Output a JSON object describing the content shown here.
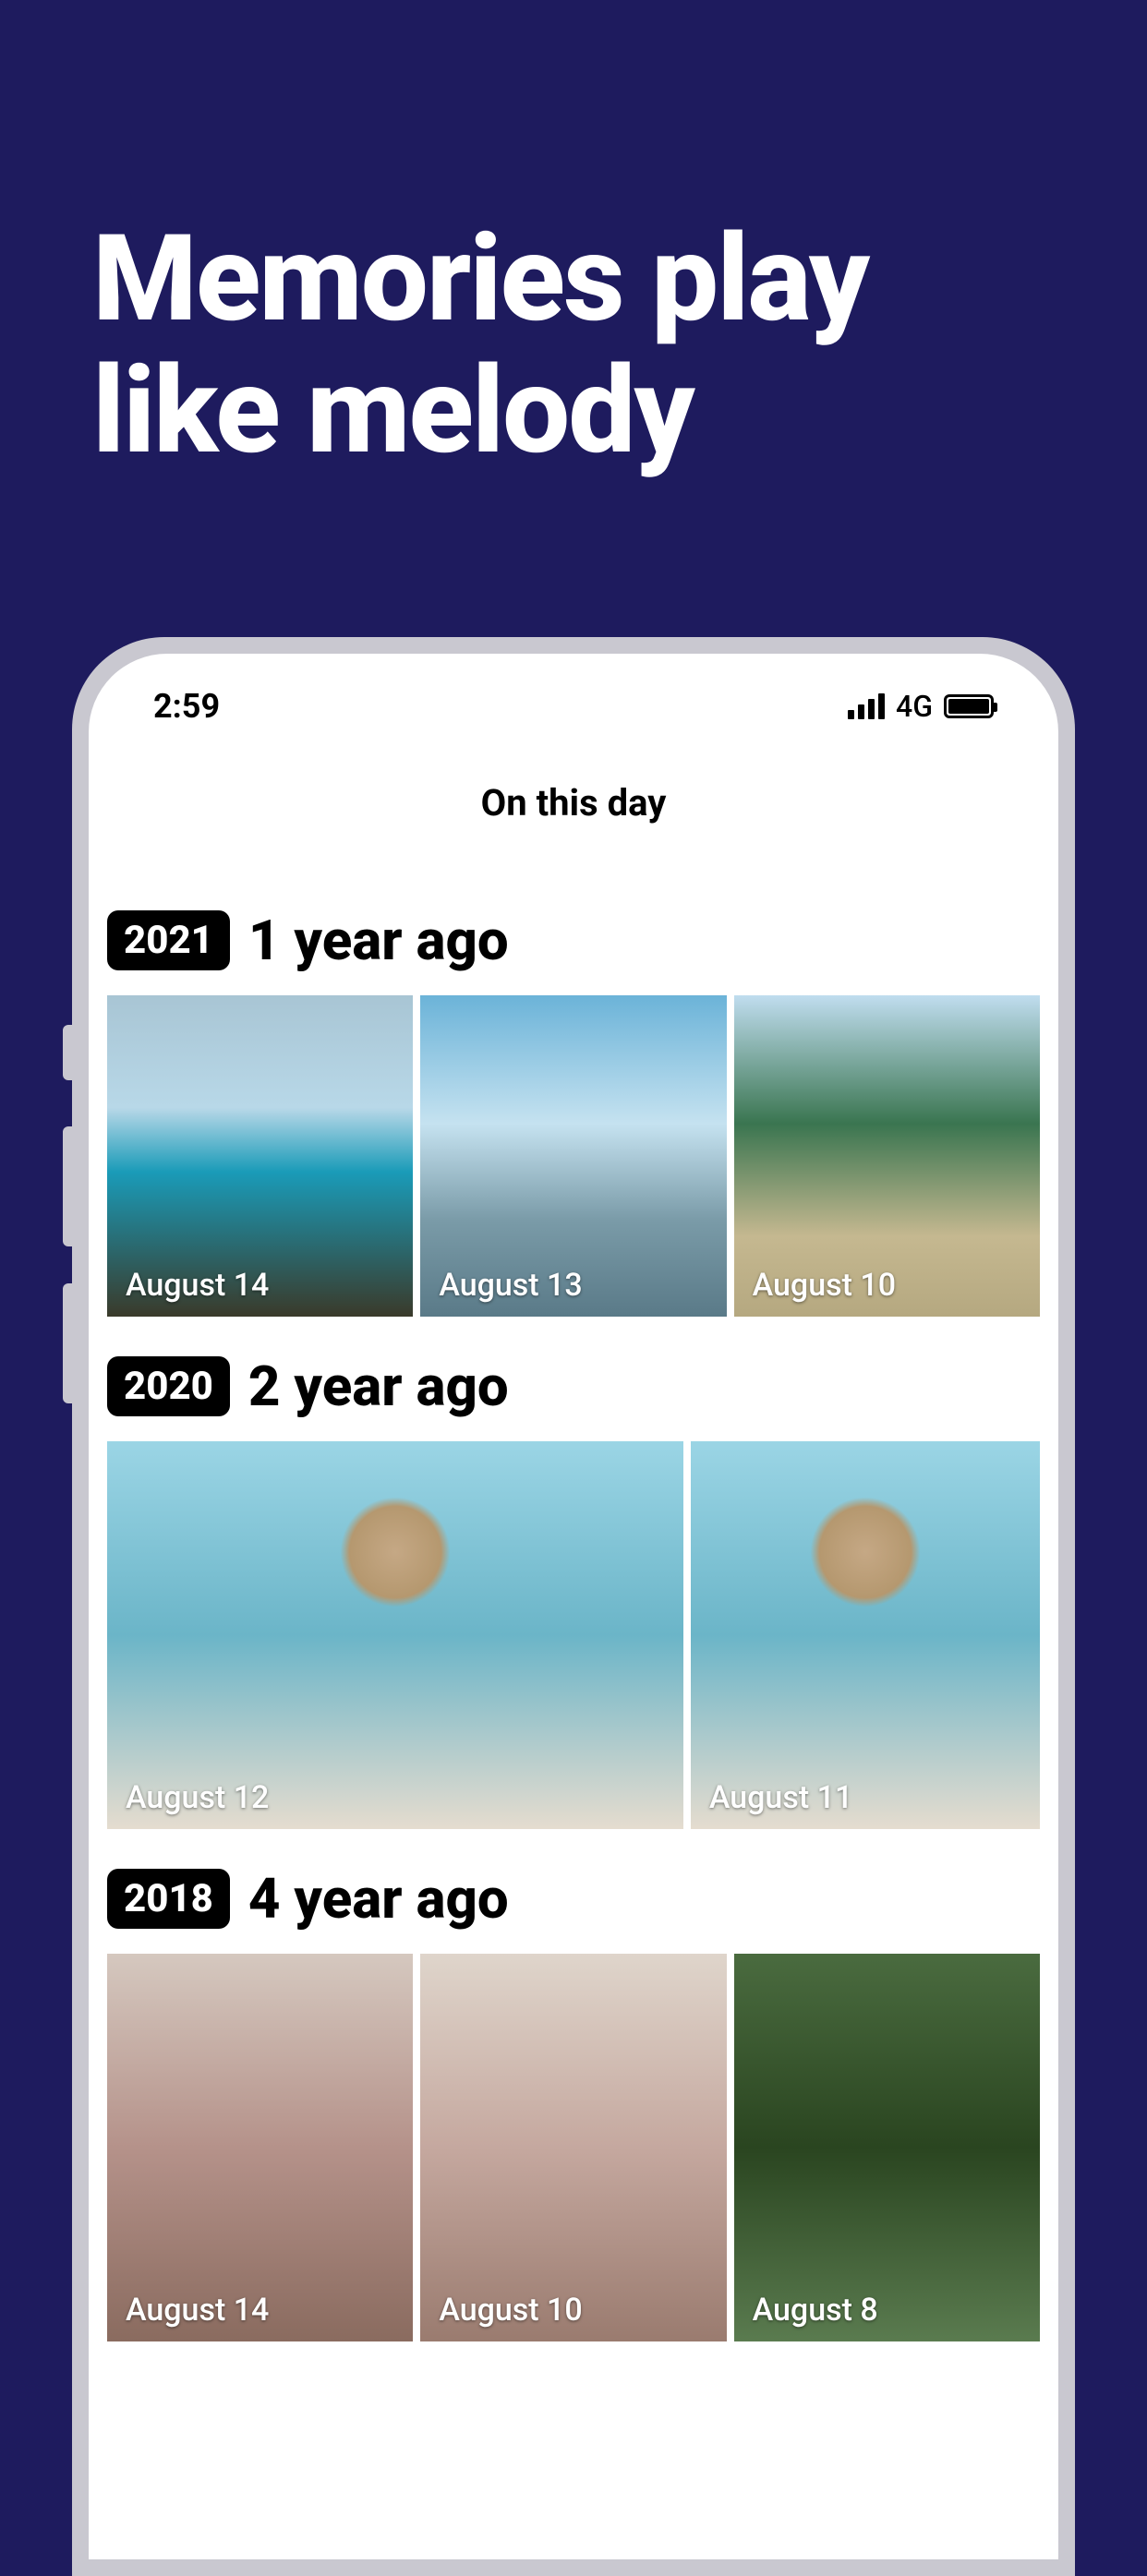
{
  "headline": "Memories play like melody",
  "statusBar": {
    "time": "2:59",
    "network": "4G"
  },
  "appTitle": "On this day",
  "sections": [
    {
      "year": "2021",
      "ago": "1 year ago",
      "photos": [
        {
          "date": "August 14"
        },
        {
          "date": "August 13"
        },
        {
          "date": "August 10"
        }
      ]
    },
    {
      "year": "2020",
      "ago": "2 year ago",
      "photos": [
        {
          "date": "August 12"
        },
        {
          "date": "August 11"
        }
      ]
    },
    {
      "year": "2018",
      "ago": "4 year ago",
      "photos": [
        {
          "date": "August 14"
        },
        {
          "date": "August 10"
        },
        {
          "date": "August 8"
        }
      ]
    }
  ]
}
